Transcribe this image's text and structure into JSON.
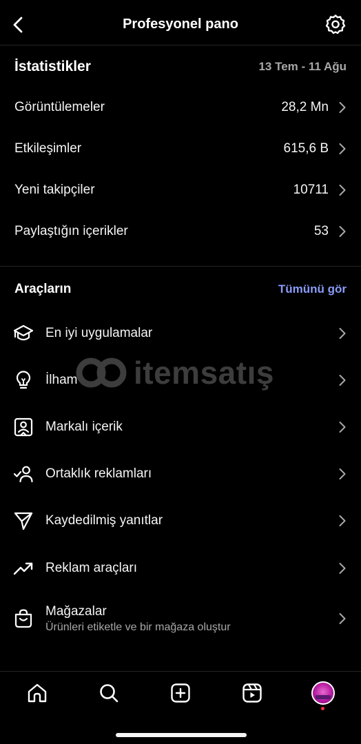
{
  "header": {
    "title": "Profesyonel pano",
    "back_icon": "chevron-left-icon",
    "settings_icon": "gear-icon"
  },
  "stats": {
    "title": "İstatistikler",
    "date_range": "13 Tem - 11 Ağu",
    "rows": [
      {
        "label": "Görüntülemeler",
        "value": "28,2 Mn"
      },
      {
        "label": "Etkileşimler",
        "value": "615,6 B"
      },
      {
        "label": "Yeni takipçiler",
        "value": "10711"
      },
      {
        "label": "Paylaştığın içerikler",
        "value": "53"
      }
    ]
  },
  "tools": {
    "title": "Araçların",
    "see_all": "Tümünü gör",
    "items": [
      {
        "label": "En iyi uygulamalar",
        "icon": "graduation-cap-icon"
      },
      {
        "label": "İlham",
        "icon": "lightbulb-icon"
      },
      {
        "label": "Markalı içerik",
        "icon": "branded-content-icon"
      },
      {
        "label": "Ortaklık reklamları",
        "icon": "partner-check-icon"
      },
      {
        "label": "Kaydedilmiş yanıtlar",
        "icon": "send-icon"
      },
      {
        "label": "Reklam araçları",
        "icon": "trend-arrow-icon"
      },
      {
        "label": "Mağazalar",
        "sublabel": "Ürünleri etiketle ve bir mağaza oluştur",
        "icon": "shopping-bag-icon"
      }
    ]
  },
  "watermark": {
    "text": "itemsatış"
  },
  "tabbar": {
    "items": [
      "home-icon",
      "search-icon",
      "create-icon",
      "reels-icon",
      "profile-avatar"
    ]
  },
  "colors": {
    "background": "#000000",
    "text": "#f5f5f5",
    "secondary_text": "#a8a8a8",
    "link": "#8a9cf9",
    "divider": "#262626",
    "notification": "#ff3040"
  }
}
